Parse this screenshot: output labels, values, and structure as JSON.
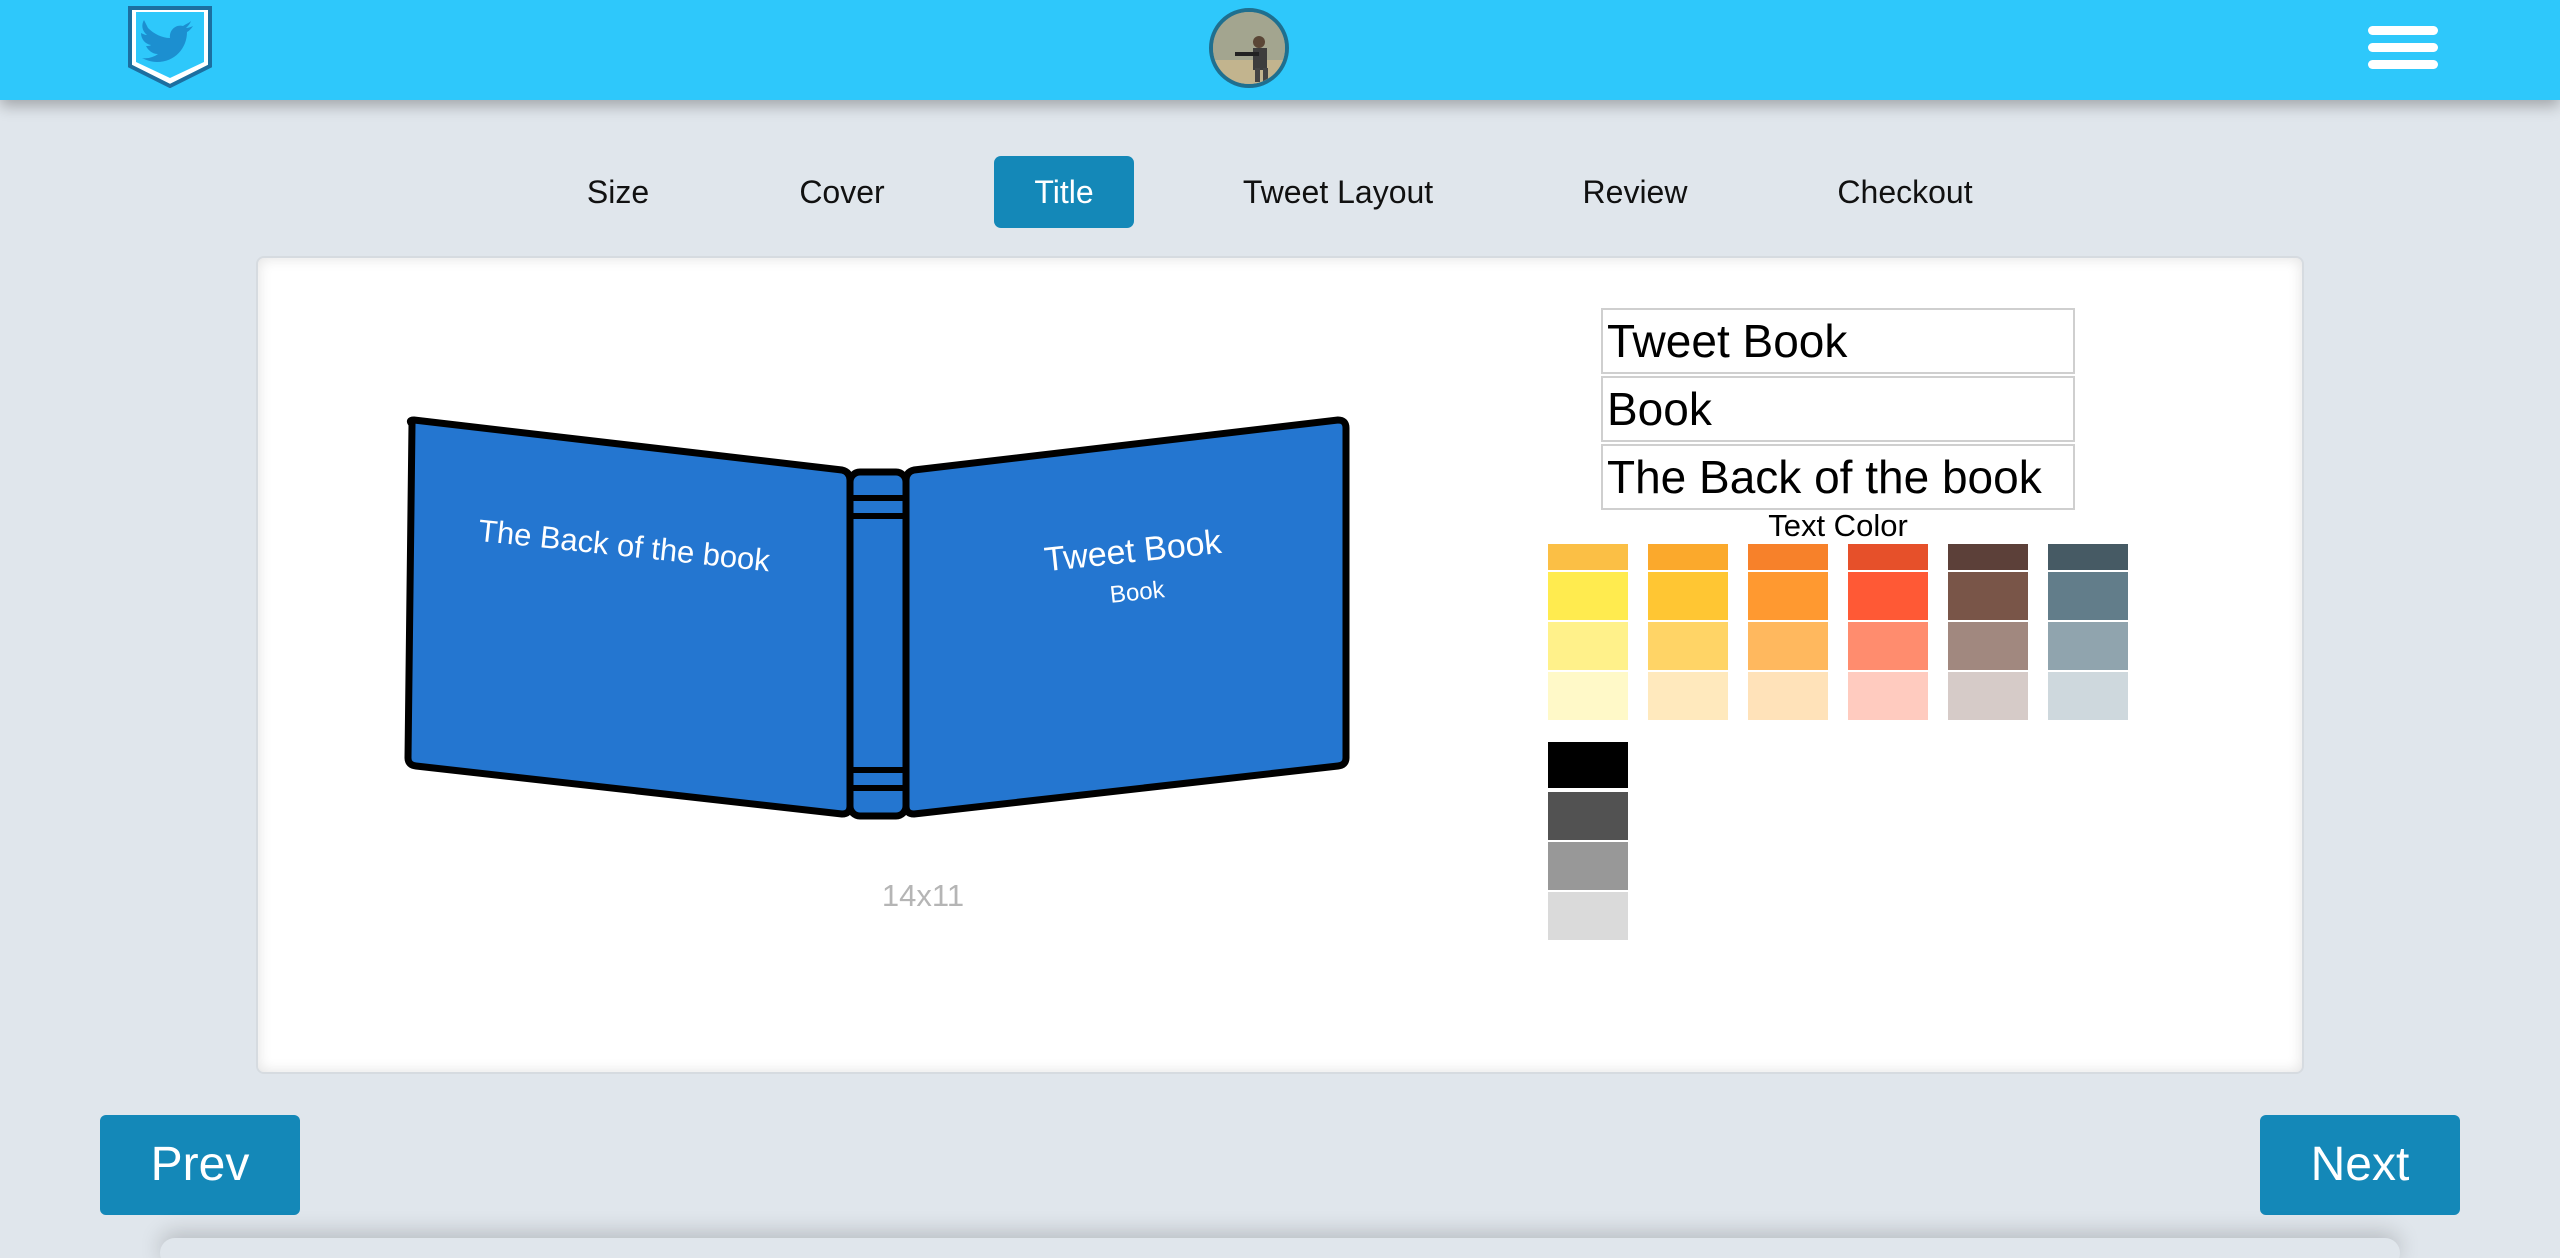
{
  "header": {
    "logo_icon": "twitter-bird-shield-icon",
    "avatar_alt": "user-avatar",
    "menu_icon": "hamburger-menu-icon",
    "bar_color": "#2ec8fb"
  },
  "tabs": [
    {
      "label": "Size",
      "active": false
    },
    {
      "label": "Cover",
      "active": false
    },
    {
      "label": "Title",
      "active": true
    },
    {
      "label": "Tweet Layout",
      "active": false
    },
    {
      "label": "Review",
      "active": false
    },
    {
      "label": "Checkout",
      "active": false
    }
  ],
  "preview": {
    "back_cover_text": "The Back of the book",
    "front_title": "Tweet Book",
    "front_subtitle": "Book",
    "cover_color": "#2476d0",
    "size_label": "14x11"
  },
  "form": {
    "title_value": "Tweet Book",
    "subtitle_value": "Book",
    "back_text_value": "The Back of the book",
    "text_color_label": "Text Color"
  },
  "palette": {
    "columns": [
      [
        "#fbbf45",
        "#ffeb4f",
        "#fff18a",
        "#fff9c8"
      ],
      [
        "#fba92c",
        "#ffc633",
        "#ffd466",
        "#ffe9bd"
      ],
      [
        "#f7812a",
        "#ff9930",
        "#ffb85e",
        "#ffe2b9"
      ],
      [
        "#e6502a",
        "#ff5935",
        "#ff8c6e",
        "#ffcbbf"
      ],
      [
        "#5c4039",
        "#795548",
        "#a1887f",
        "#d6cbc8"
      ],
      [
        "#465a64",
        "#627d8a",
        "#90a4ae",
        "#ced8dd"
      ]
    ],
    "grays": [
      "#000000",
      "#525252",
      "#989898",
      "#dadada"
    ]
  },
  "footer": {
    "prev_label": "Prev",
    "next_label": "Next",
    "button_color": "#1488b8"
  }
}
